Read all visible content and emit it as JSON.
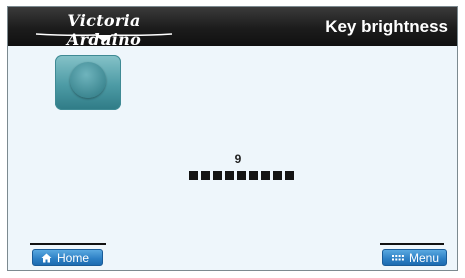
{
  "header": {
    "brand_text": "Victoria Arduino",
    "title": "Key brightness"
  },
  "setting": {
    "value": "9",
    "level": 9,
    "max_level": 9
  },
  "footer": {
    "home_label": "Home",
    "menu_label": "Menu"
  },
  "icons": {
    "home": "home-icon",
    "menu": "menu-grid-icon",
    "key": "key-preview-icon"
  },
  "colors": {
    "accent": "#2c7fc4",
    "header_bg": "#1c1c1c",
    "panel_bg": "#eef6fb",
    "key_tile": "#4d9ba5"
  }
}
